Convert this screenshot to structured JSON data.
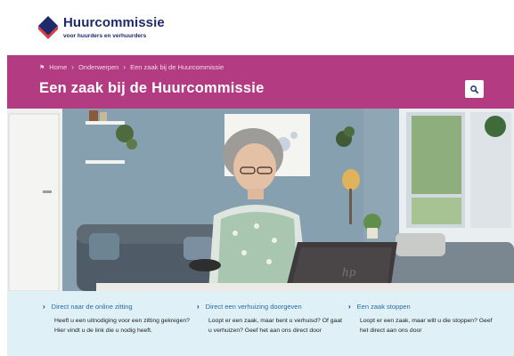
{
  "brand": {
    "name": "Huurcommissie",
    "tagline": "voor huurders en verhuurders",
    "colors": {
      "navy": "#1f2a6b",
      "red": "#e03a3e",
      "magenta": "#b33b82"
    }
  },
  "breadcrumb": {
    "items": [
      "Home",
      "Onderwerpen",
      "Een zaak bij de Huurcommissie"
    ]
  },
  "header": {
    "title": "Een zaak bij de Huurcommissie",
    "search_icon": "search-icon"
  },
  "links": [
    {
      "title": "Direct naar de online zitting",
      "text": "Heeft u een uitnodiging voor een zitting gekregen? Hier vindt u de link die u nodig heeft."
    },
    {
      "title": "Direct een verhuizing doorgeven",
      "text": "Loopt er een zaak, maar bent u verhuisd? Of gaat u verhuizen? Geef het aan ons direct door"
    },
    {
      "title": "Een zaak stoppen",
      "text": "Loopt er een zaak, maar wilt u die stoppen? Geef het direct aan ons door"
    }
  ]
}
